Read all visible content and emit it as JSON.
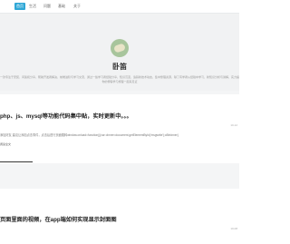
{
  "nav": {
    "items": [
      {
        "label": "首页",
        "active": true
      },
      {
        "label": "生活",
        "active": false
      },
      {
        "label": "问题",
        "active": false
      },
      {
        "label": "基础",
        "active": false
      },
      {
        "label": "关于",
        "active": false
      }
    ]
  },
  "header": {
    "title": "卧笛",
    "desc_line1": "一款专注于安装、问答和分享，帮助开发者解决，前端进阶与学习交流，通过一些学习者经验分享，知识沉淀，追踪新技术动态，集中整理资源，除了有学者从经验中学习，新知识分析与讲解，实力提升的社区学院",
    "desc_line2": "你的博客学习旅程一起来见证"
  },
  "articles": [
    {
      "title": "php、js、mysql等功能代码集中贴，实时更新中。。。",
      "meta": "10-12",
      "excerpt": "添加好友 建议让添加点击事件，点击后进行页面跳转window.onload=function(){var oInner=document.getElementById('msgwrite');oBtnInner}",
      "read_more": "阅读全文"
    },
    {
      "title": "页面里面的视频，在app端如何实现显示封面图",
      "meta": "10-08"
    }
  ],
  "colors": {
    "accent": "#2fa7d6",
    "logo_green": "#a8c59c"
  }
}
